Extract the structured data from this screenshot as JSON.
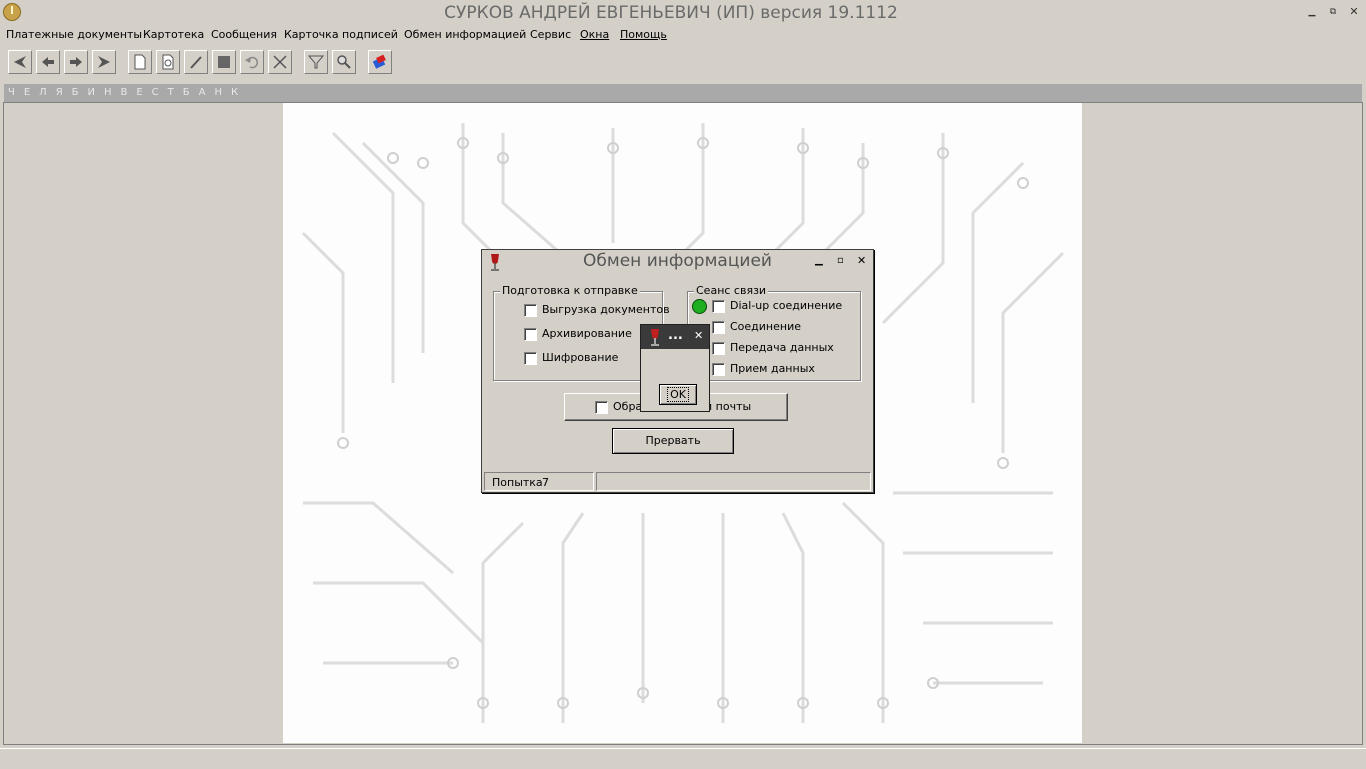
{
  "app": {
    "title": "СУРКОВ АНДРЕЙ ЕВГЕНЬЕВИЧ (ИП)  версия 19.1112"
  },
  "menu": {
    "items": [
      "Платежные документы",
      "Картотека",
      "Сообщения",
      "Карточка подписей",
      "Обмен информацией",
      "Сервис",
      "Окна",
      "Помощь"
    ]
  },
  "toolbar": {
    "buttons": [
      "first",
      "prev",
      "next",
      "last",
      "new-doc",
      "preview",
      "edit",
      "stop",
      "undo",
      "delete",
      "filter",
      "find",
      "sign"
    ]
  },
  "bank": {
    "name": "ЧЕЛЯБИНВЕСТБАНК"
  },
  "dialog": {
    "title": "Обмен информацией",
    "prep_group": {
      "label": "Подготовка к отправке",
      "items": [
        "Выгрузка документов",
        "Архивирование",
        "Шифрование"
      ]
    },
    "session_group": {
      "label": "Сеанс связи",
      "items": [
        "Dial-up соединение",
        "Соединение",
        "Передача данных",
        "Прием данных"
      ],
      "indicator_color": "#1fae1f"
    },
    "mail_checkbox_left": "Обра",
    "mail_checkbox_right": "й почты",
    "abort_button": "Прервать",
    "status": {
      "attempt_label": "Попытка",
      "attempt_value": "7"
    }
  },
  "popup": {
    "title": "...",
    "ok_button": "OK"
  },
  "colors": {
    "window_bg": "#d4d0c8",
    "bank_strip": "#a9a9a9",
    "workspace_bg": "#fdfdfd"
  }
}
